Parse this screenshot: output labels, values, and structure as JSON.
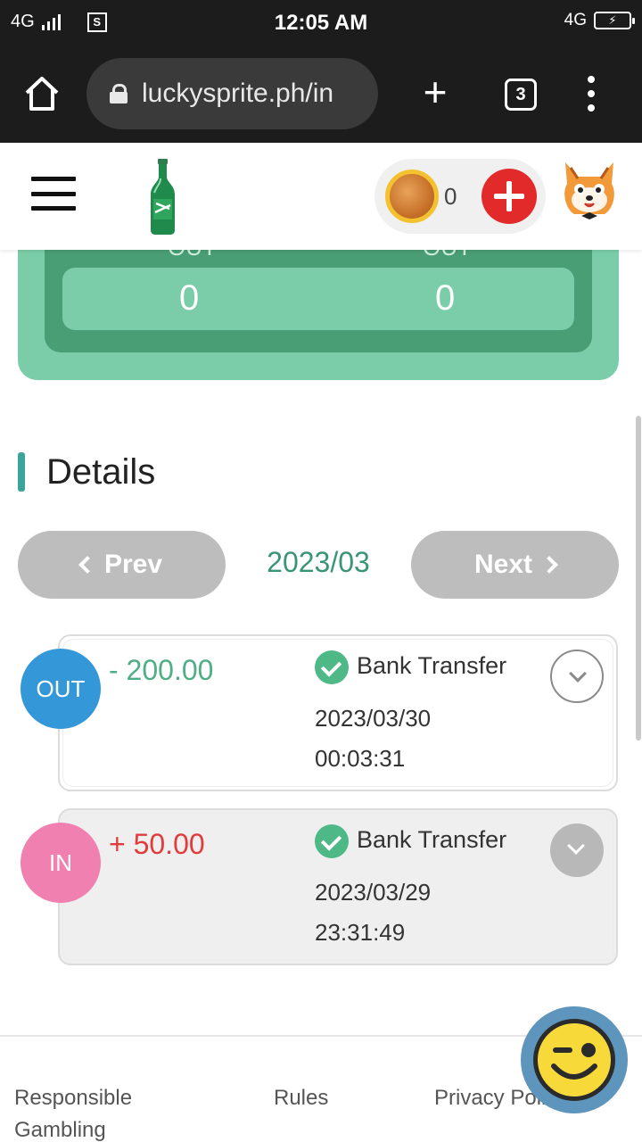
{
  "status_bar": {
    "network_left": "4G",
    "time": "12:05 AM",
    "network_right": "4G",
    "sim_label": "S"
  },
  "browser": {
    "url": "luckysprite.ph/in",
    "tab_count": "3"
  },
  "header": {
    "balance": "0"
  },
  "summary": {
    "labels": [
      "OUT",
      "OUT"
    ],
    "values": [
      "0",
      "0"
    ]
  },
  "details": {
    "title": "Details",
    "prev_label": "Prev",
    "next_label": "Next",
    "month": "2023/03"
  },
  "transactions": [
    {
      "direction": "OUT",
      "amount": "- 200.00",
      "method": "Bank Transfer",
      "date": "2023/03/30",
      "time": "00:03:31"
    },
    {
      "direction": "IN",
      "amount": "+ 50.00",
      "method": "Bank Transfer",
      "date": "2023/03/29",
      "time": "23:31:49"
    }
  ],
  "footer": {
    "links": [
      "Responsible Gambling",
      "Rules",
      "Privacy Poli"
    ]
  },
  "colors": {
    "accent_green": "#4fae85",
    "out_badge": "#3497d8",
    "in_badge": "#f080b0",
    "negative_amount": "#4fae85",
    "positive_amount": "#e23b3b",
    "deposit_red": "#e32a2a"
  },
  "icons": {
    "home": "home-icon",
    "lock": "lock-icon",
    "new_tab": "plus-icon",
    "overflow": "more-vert-icon",
    "menu": "hamburger-icon",
    "logo": "sprite-bottle-logo",
    "coin": "coin-icon",
    "deposit": "plus-circle-icon",
    "avatar": "fox-avatar",
    "status_ok": "check-circle-icon",
    "expand": "chevron-down-icon",
    "chat": "smiley-chat-icon"
  }
}
